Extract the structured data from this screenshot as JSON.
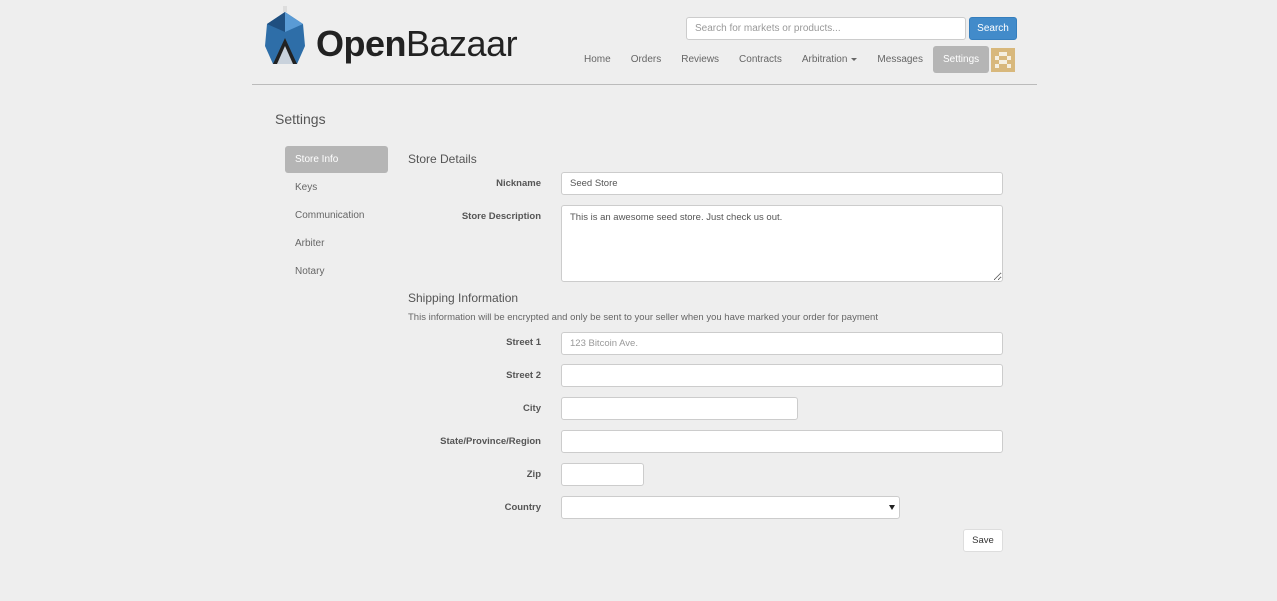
{
  "header": {
    "logo": {
      "text_bold": "Open",
      "text_regular": "Bazaar",
      "icon": "openbazaar-logo-icon"
    },
    "search": {
      "placeholder": "Search for markets or products...",
      "button_label": "Search"
    },
    "nav": [
      {
        "label": "Home"
      },
      {
        "label": "Orders"
      },
      {
        "label": "Reviews"
      },
      {
        "label": "Contracts"
      },
      {
        "label": "Arbitration"
      },
      {
        "label": "Messages"
      },
      {
        "label": "Settings",
        "active": true
      }
    ],
    "avatar_icon": "pixel-avatar-icon"
  },
  "page": {
    "title": "Settings"
  },
  "sidebar": {
    "items": [
      {
        "label": "Store Info",
        "active": true
      },
      {
        "label": "Keys"
      },
      {
        "label": "Communication"
      },
      {
        "label": "Arbiter"
      },
      {
        "label": "Notary"
      }
    ]
  },
  "store_details": {
    "title": "Store Details",
    "nickname": {
      "label": "Nickname",
      "value": "Seed Store"
    },
    "description": {
      "label": "Store Description",
      "value": "This is an awesome seed store. Just check us out."
    }
  },
  "shipping": {
    "title": "Shipping Information",
    "note": "This information will be encrypted and only be sent to your seller when you have marked your order for payment",
    "street1": {
      "label": "Street 1",
      "placeholder": "123 Bitcoin Ave."
    },
    "street2": {
      "label": "Street 2",
      "placeholder": ""
    },
    "city": {
      "label": "City",
      "placeholder": ""
    },
    "state": {
      "label": "State/Province/Region",
      "placeholder": ""
    },
    "zip": {
      "label": "Zip",
      "placeholder": ""
    },
    "country": {
      "label": "Country",
      "value": ""
    }
  },
  "actions": {
    "save_label": "Save"
  },
  "colors": {
    "primary": "#428bca",
    "active_nav": "#b5b5b5",
    "background": "#eeeeee"
  }
}
